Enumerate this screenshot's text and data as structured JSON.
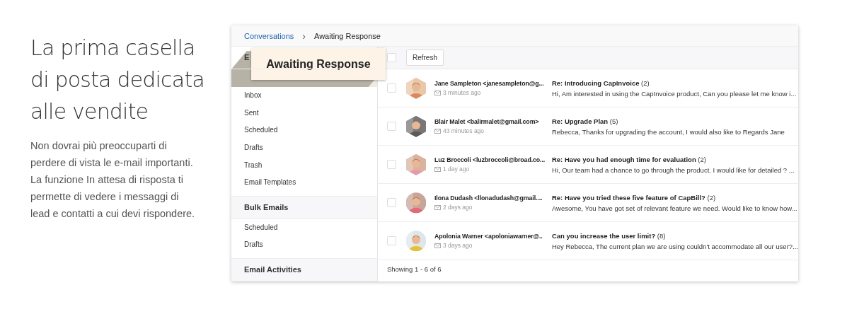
{
  "intro": {
    "title": "La prima casella di posta dedicata alle vendite",
    "text": "Non dovrai più preoccuparti di perdere di vista le e-mail importanti. La funzione In attesa di risposta ti permette di vedere i messaggi di lead e contatti a cui devi rispondere."
  },
  "breadcrumb": [
    {
      "label": "Conversations",
      "kind": "link"
    },
    {
      "label": "Awaiting Response",
      "kind": "current",
      "separator": "›"
    }
  ],
  "sidebar": {
    "sections": [
      {
        "title": "E",
        "items": [
          {
            "label": "Awaiting Response",
            "selected": true
          },
          {
            "label": "Inbox",
            "selected": false
          },
          {
            "label": "Sent",
            "selected": false
          },
          {
            "label": "Scheduled",
            "selected": false
          },
          {
            "label": "Drafts",
            "selected": false
          },
          {
            "label": "Trash",
            "selected": false
          },
          {
            "label": "Email Templates",
            "selected": false
          }
        ]
      },
      {
        "title": "Bulk Emails",
        "items": [
          {
            "label": "Scheduled",
            "selected": false
          },
          {
            "label": "Drafts",
            "selected": false
          }
        ]
      },
      {
        "title": "Email Activities"
      }
    ]
  },
  "toolbar": {
    "select_all": {
      "checked": false
    },
    "refresh": "Refresh"
  },
  "messages": [
    {
      "checked": false,
      "kind": "hexagon",
      "sender": "Jane Sampleton <janesampleton@g...",
      "time": "3 minutes ago",
      "subject": "Re: Introducing CapInvoice",
      "count": "(2)",
      "preview": "Hi, Am interested in using the CapInvoice product, Can you please let me know i..."
    },
    {
      "checked": false,
      "kind": "hexagon",
      "sender": "Blair Malet <balirmalet@gmail.com>",
      "time": "43 minutes ago",
      "subject": "Re: Upgrade Plan",
      "count": "(5)",
      "preview": "Rebecca, Thanks for upgrading the account, I would also like to Regards Jane"
    },
    {
      "checked": false,
      "kind": "hexagon",
      "sender": "Luz Broccoli <luzbroccoli@broad.co...",
      "time": "1 day ago",
      "subject": "Re: Have you had enough time for evaluation",
      "count": "(2)",
      "preview": "Hi, Our team had a chance to go through the product. I would like for detailed ? ..."
    },
    {
      "checked": false,
      "kind": "circle",
      "sender": "Ilona Dudash <llonadudash@gmail....",
      "time": "2 days ago",
      "subject": "Re: Have you tried these five feature of CapBill?",
      "count": "(2)",
      "preview": "Awesome, You have got set of relevant feature we need. Would like to know how..."
    },
    {
      "checked": false,
      "kind": "circle",
      "sender": "Apolonia Warner <apoloniawarner@..",
      "time": "3 days ago",
      "subject": "Can you increase the user limit?",
      "count": "(8)",
      "preview": "Hey Rebecca, The current plan we are using couldn't accommodate all our user?..."
    }
  ],
  "footer": "Showing 1 - 6 of 6"
}
